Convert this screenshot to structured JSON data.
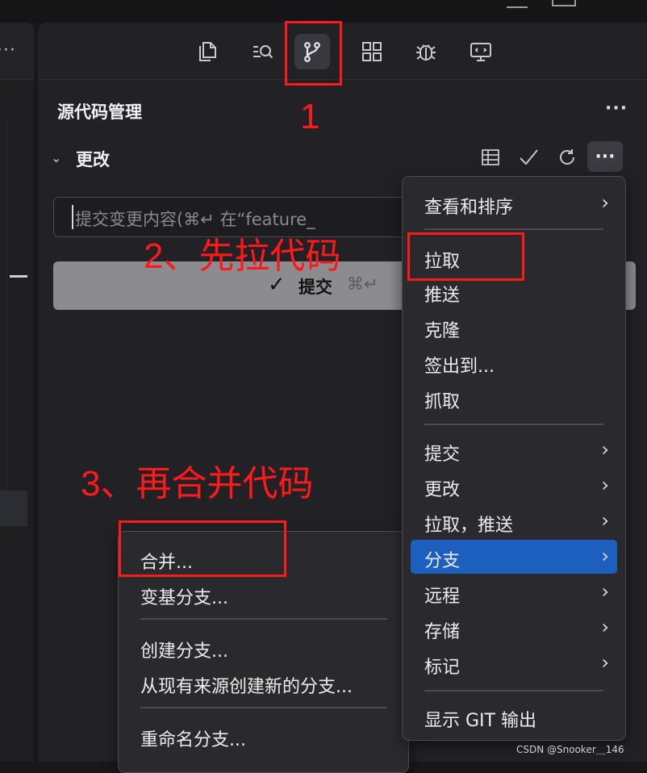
{
  "activity_bar": {
    "items": [
      {
        "name": "explorer-icon"
      },
      {
        "name": "search-icon"
      },
      {
        "name": "source-control-icon"
      },
      {
        "name": "extensions-icon"
      },
      {
        "name": "debug-icon"
      },
      {
        "name": "remote-explorer-icon"
      }
    ]
  },
  "panel": {
    "title": "源代码管理",
    "more": "···"
  },
  "changes": {
    "title": "更改",
    "commit_placeholder": "提交变更内容(⌘↵ 在“feature_",
    "commit_button": "提交",
    "commit_check": "✓",
    "commit_shortcut": "⌘↵"
  },
  "annotations": {
    "step1": "1",
    "step2": "2、先拉代码",
    "step3": "3、再合并代码"
  },
  "main_menu": {
    "items": [
      {
        "label": "查看和排序",
        "submenu": true
      },
      {
        "label": "拉取",
        "submenu": false
      },
      {
        "label": "推送",
        "submenu": false
      },
      {
        "label": "克隆",
        "submenu": false
      },
      {
        "label": "签出到...",
        "submenu": false
      },
      {
        "label": "抓取",
        "submenu": false
      },
      {
        "label": "提交",
        "submenu": true
      },
      {
        "label": "更改",
        "submenu": true
      },
      {
        "label": "拉取，推送",
        "submenu": true
      },
      {
        "label": "分支",
        "submenu": true,
        "active": true
      },
      {
        "label": "远程",
        "submenu": true
      },
      {
        "label": "存储",
        "submenu": true
      },
      {
        "label": "标记",
        "submenu": true
      },
      {
        "label": "显示 GIT 输出",
        "submenu": false
      }
    ]
  },
  "branch_menu": {
    "items": [
      {
        "label": "合并..."
      },
      {
        "label": "变基分支..."
      },
      {
        "label": "创建分支..."
      },
      {
        "label": "从现有来源创建新的分支..."
      },
      {
        "label": "重命名分支..."
      }
    ]
  },
  "watermark": "CSDN @Snooker＿146",
  "colors": {
    "highlight": "#ff1a1a",
    "menu_active": "#1d5fbf",
    "background": "#222226"
  }
}
